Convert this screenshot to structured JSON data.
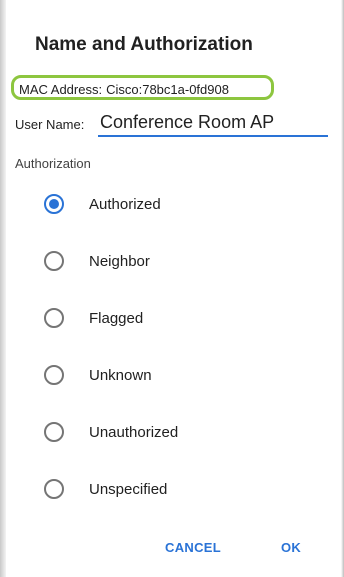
{
  "dialog": {
    "title": "Name and Authorization",
    "mac_label": "MAC Address:",
    "mac_value": "Cisco:78bc1a-0fd908",
    "user_name_label": "User Name:",
    "user_name_value": "Conference Room AP",
    "authorization_label": "Authorization",
    "options": [
      {
        "label": "Authorized",
        "selected": true
      },
      {
        "label": "Neighbor",
        "selected": false
      },
      {
        "label": "Flagged",
        "selected": false
      },
      {
        "label": "Unknown",
        "selected": false
      },
      {
        "label": "Unauthorized",
        "selected": false
      },
      {
        "label": "Unspecified",
        "selected": false
      }
    ],
    "cancel_label": "CANCEL",
    "ok_label": "OK"
  },
  "colors": {
    "accent": "#2a73d6",
    "highlight": "#8dc63f",
    "text": "#212121"
  }
}
